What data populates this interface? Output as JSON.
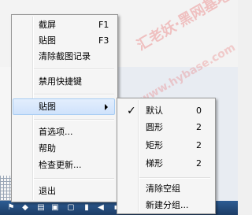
{
  "watermark": {
    "line1": "汇老妖·黑网基地",
    "line2": "www.hybase.com"
  },
  "main_menu": {
    "items": [
      {
        "label": "截屏",
        "shortcut": "F1"
      },
      {
        "label": "贴图",
        "shortcut": "F3"
      },
      {
        "label": "清除截图记录",
        "shortcut": ""
      },
      {
        "label": "禁用快捷键",
        "shortcut": ""
      },
      {
        "label": "贴图",
        "shortcut": ""
      },
      {
        "label": "首选项...",
        "shortcut": ""
      },
      {
        "label": "帮助",
        "shortcut": ""
      },
      {
        "label": "检查更新...",
        "shortcut": ""
      },
      {
        "label": "退出",
        "shortcut": ""
      }
    ]
  },
  "sub_menu": {
    "items": [
      {
        "label": "默认",
        "count": "0",
        "checked": true
      },
      {
        "label": "圆形",
        "count": "2"
      },
      {
        "label": "矩形",
        "count": "2"
      },
      {
        "label": "梯形",
        "count": "2"
      },
      {
        "label": "清除空组",
        "count": ""
      },
      {
        "label": "新建分组...",
        "count": ""
      }
    ]
  },
  "tray": {
    "icons": [
      "flag-icon",
      "shield-icon",
      "document-icon",
      "network-icon",
      "volume-icon"
    ]
  }
}
